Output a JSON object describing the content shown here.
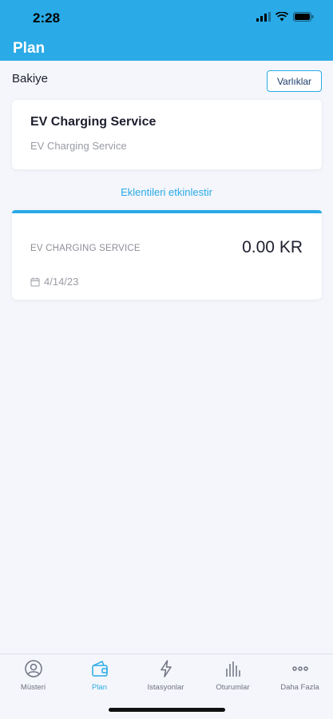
{
  "status": {
    "time": "2:28"
  },
  "header": {
    "title": "Plan"
  },
  "balance": {
    "label": "Bakiye",
    "assets_button": "Varlıklar"
  },
  "service_card": {
    "title": "EV Charging Service",
    "subtitle": "EV Charging Service"
  },
  "enable_addons_link": "Eklentileri etkinlestir",
  "plan_card": {
    "name": "EV CHARGING SERVICE",
    "amount": "0.00 KR",
    "date": "4/14/23"
  },
  "tabs": [
    {
      "label": "Müsteri",
      "icon": "user-icon",
      "active": false
    },
    {
      "label": "Plan",
      "icon": "wallet-icon",
      "active": true
    },
    {
      "label": "Istasyonlar",
      "icon": "lightning-icon",
      "active": false
    },
    {
      "label": "Oturumlar",
      "icon": "bars-icon",
      "active": false
    },
    {
      "label": "Daha Fazla",
      "icon": "more-icon",
      "active": false
    }
  ],
  "colors": {
    "accent": "#2aaae6",
    "background": "#f4f6fb",
    "text": "#1d1f2e",
    "muted": "#9a9ca5"
  }
}
